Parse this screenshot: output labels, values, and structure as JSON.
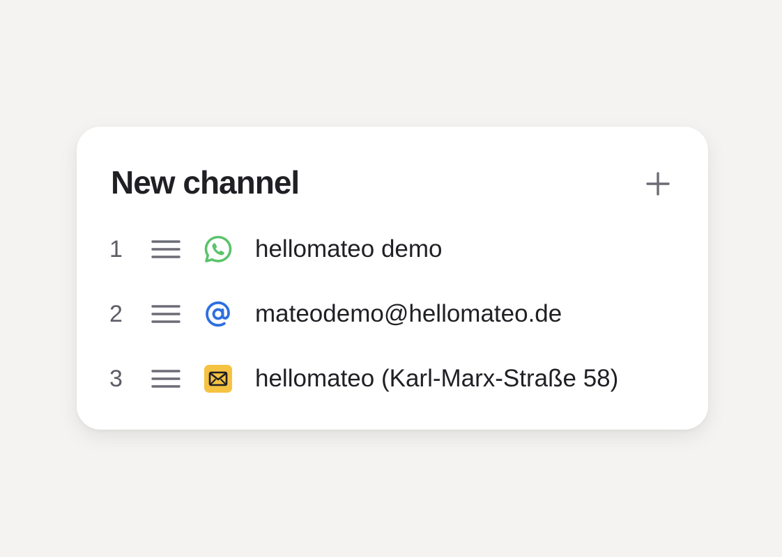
{
  "panel": {
    "title": "New channel",
    "add_icon": "plus-icon"
  },
  "channels": [
    {
      "index": "1",
      "handle_icon": "drag-handle-icon",
      "icon": "whatsapp-icon",
      "icon_color": "#5ac36b",
      "label": "hellomateo demo"
    },
    {
      "index": "2",
      "handle_icon": "drag-handle-icon",
      "icon": "at-sign-icon",
      "icon_color": "#2f6fe0",
      "label": "mateodemo@hellomateo.de"
    },
    {
      "index": "3",
      "handle_icon": "drag-handle-icon",
      "icon": "envelope-icon",
      "icon_color": "#f5c242",
      "label": "hellomateo (Karl-Marx-Straße 58)"
    }
  ],
  "colors": {
    "background": "#f4f3f1",
    "card": "#ffffff",
    "text": "#1f1f24",
    "muted": "#5c5d66"
  }
}
